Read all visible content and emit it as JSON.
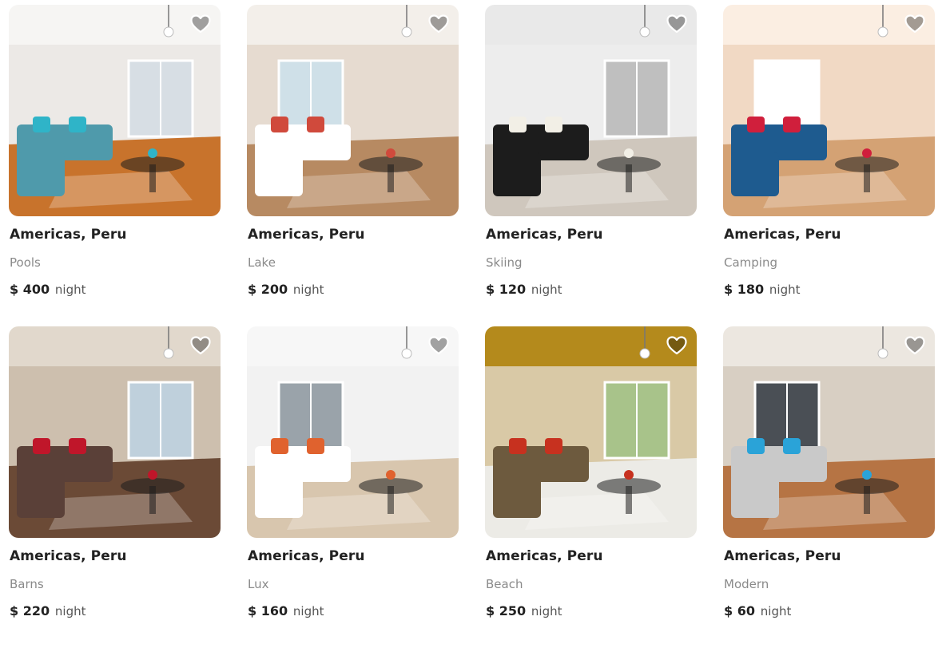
{
  "listings": [
    {
      "location": "Americas, Peru",
      "category": "Pools",
      "currency": "$",
      "price": "400",
      "unit": "night",
      "colors": {
        "wall": "#ece9e6",
        "floor": "#c8732c",
        "sofa": "#4f9aab",
        "accent": "#2fb4c8",
        "ceiling": "#f6f5f3",
        "window": "#d7dee4"
      }
    },
    {
      "location": "Americas, Peru",
      "category": "Lake",
      "currency": "$",
      "price": "200",
      "unit": "night",
      "colors": {
        "wall": "#e6dbd0",
        "floor": "#b78a62",
        "sofa": "#ffffff",
        "accent": "#d04a3c",
        "ceiling": "#f3efea",
        "window": "#cfe0e8"
      }
    },
    {
      "location": "Americas, Peru",
      "category": "Skiing",
      "currency": "$",
      "price": "120",
      "unit": "night",
      "colors": {
        "wall": "#ededed",
        "floor": "#cfc7bd",
        "sofa": "#1c1c1c",
        "accent": "#f2efe6",
        "ceiling": "#e9e9e9",
        "window": "#bfbfbf"
      }
    },
    {
      "location": "Americas, Peru",
      "category": "Camping",
      "currency": "$",
      "price": "180",
      "unit": "night",
      "colors": {
        "wall": "#f1d9c4",
        "floor": "#d4a274",
        "sofa": "#1e5b8f",
        "accent": "#d01f3c",
        "ceiling": "#fbeee2",
        "window": "#ffffff"
      }
    },
    {
      "location": "Americas, Peru",
      "category": "Barns",
      "currency": "$",
      "price": "220",
      "unit": "night",
      "colors": {
        "wall": "#cdbfae",
        "floor": "#6b4a36",
        "sofa": "#5a4038",
        "accent": "#c0162a",
        "ceiling": "#e1d8cc",
        "window": "#bfd0dc"
      }
    },
    {
      "location": "Americas, Peru",
      "category": "Lux",
      "currency": "$",
      "price": "160",
      "unit": "night",
      "colors": {
        "wall": "#f2f2f2",
        "floor": "#d8c6ae",
        "sofa": "#ffffff",
        "accent": "#e0622e",
        "ceiling": "#f7f7f7",
        "window": "#9aa3aa"
      }
    },
    {
      "location": "Americas, Peru",
      "category": "Beach",
      "currency": "$",
      "price": "250",
      "unit": "night",
      "colors": {
        "wall": "#d9c9a6",
        "floor": "#ecebe6",
        "sofa": "#6d5a3e",
        "accent": "#c7311f",
        "ceiling": "#b48a1c",
        "window": "#a8c38a"
      }
    },
    {
      "location": "Americas, Peru",
      "category": "Modern",
      "currency": "$",
      "price": "60",
      "unit": "night",
      "colors": {
        "wall": "#d8cfc3",
        "floor": "#b67444",
        "sofa": "#c9c9c9",
        "accent": "#2aa3d8",
        "ceiling": "#ece7e0",
        "window": "#4a4f55"
      }
    }
  ]
}
